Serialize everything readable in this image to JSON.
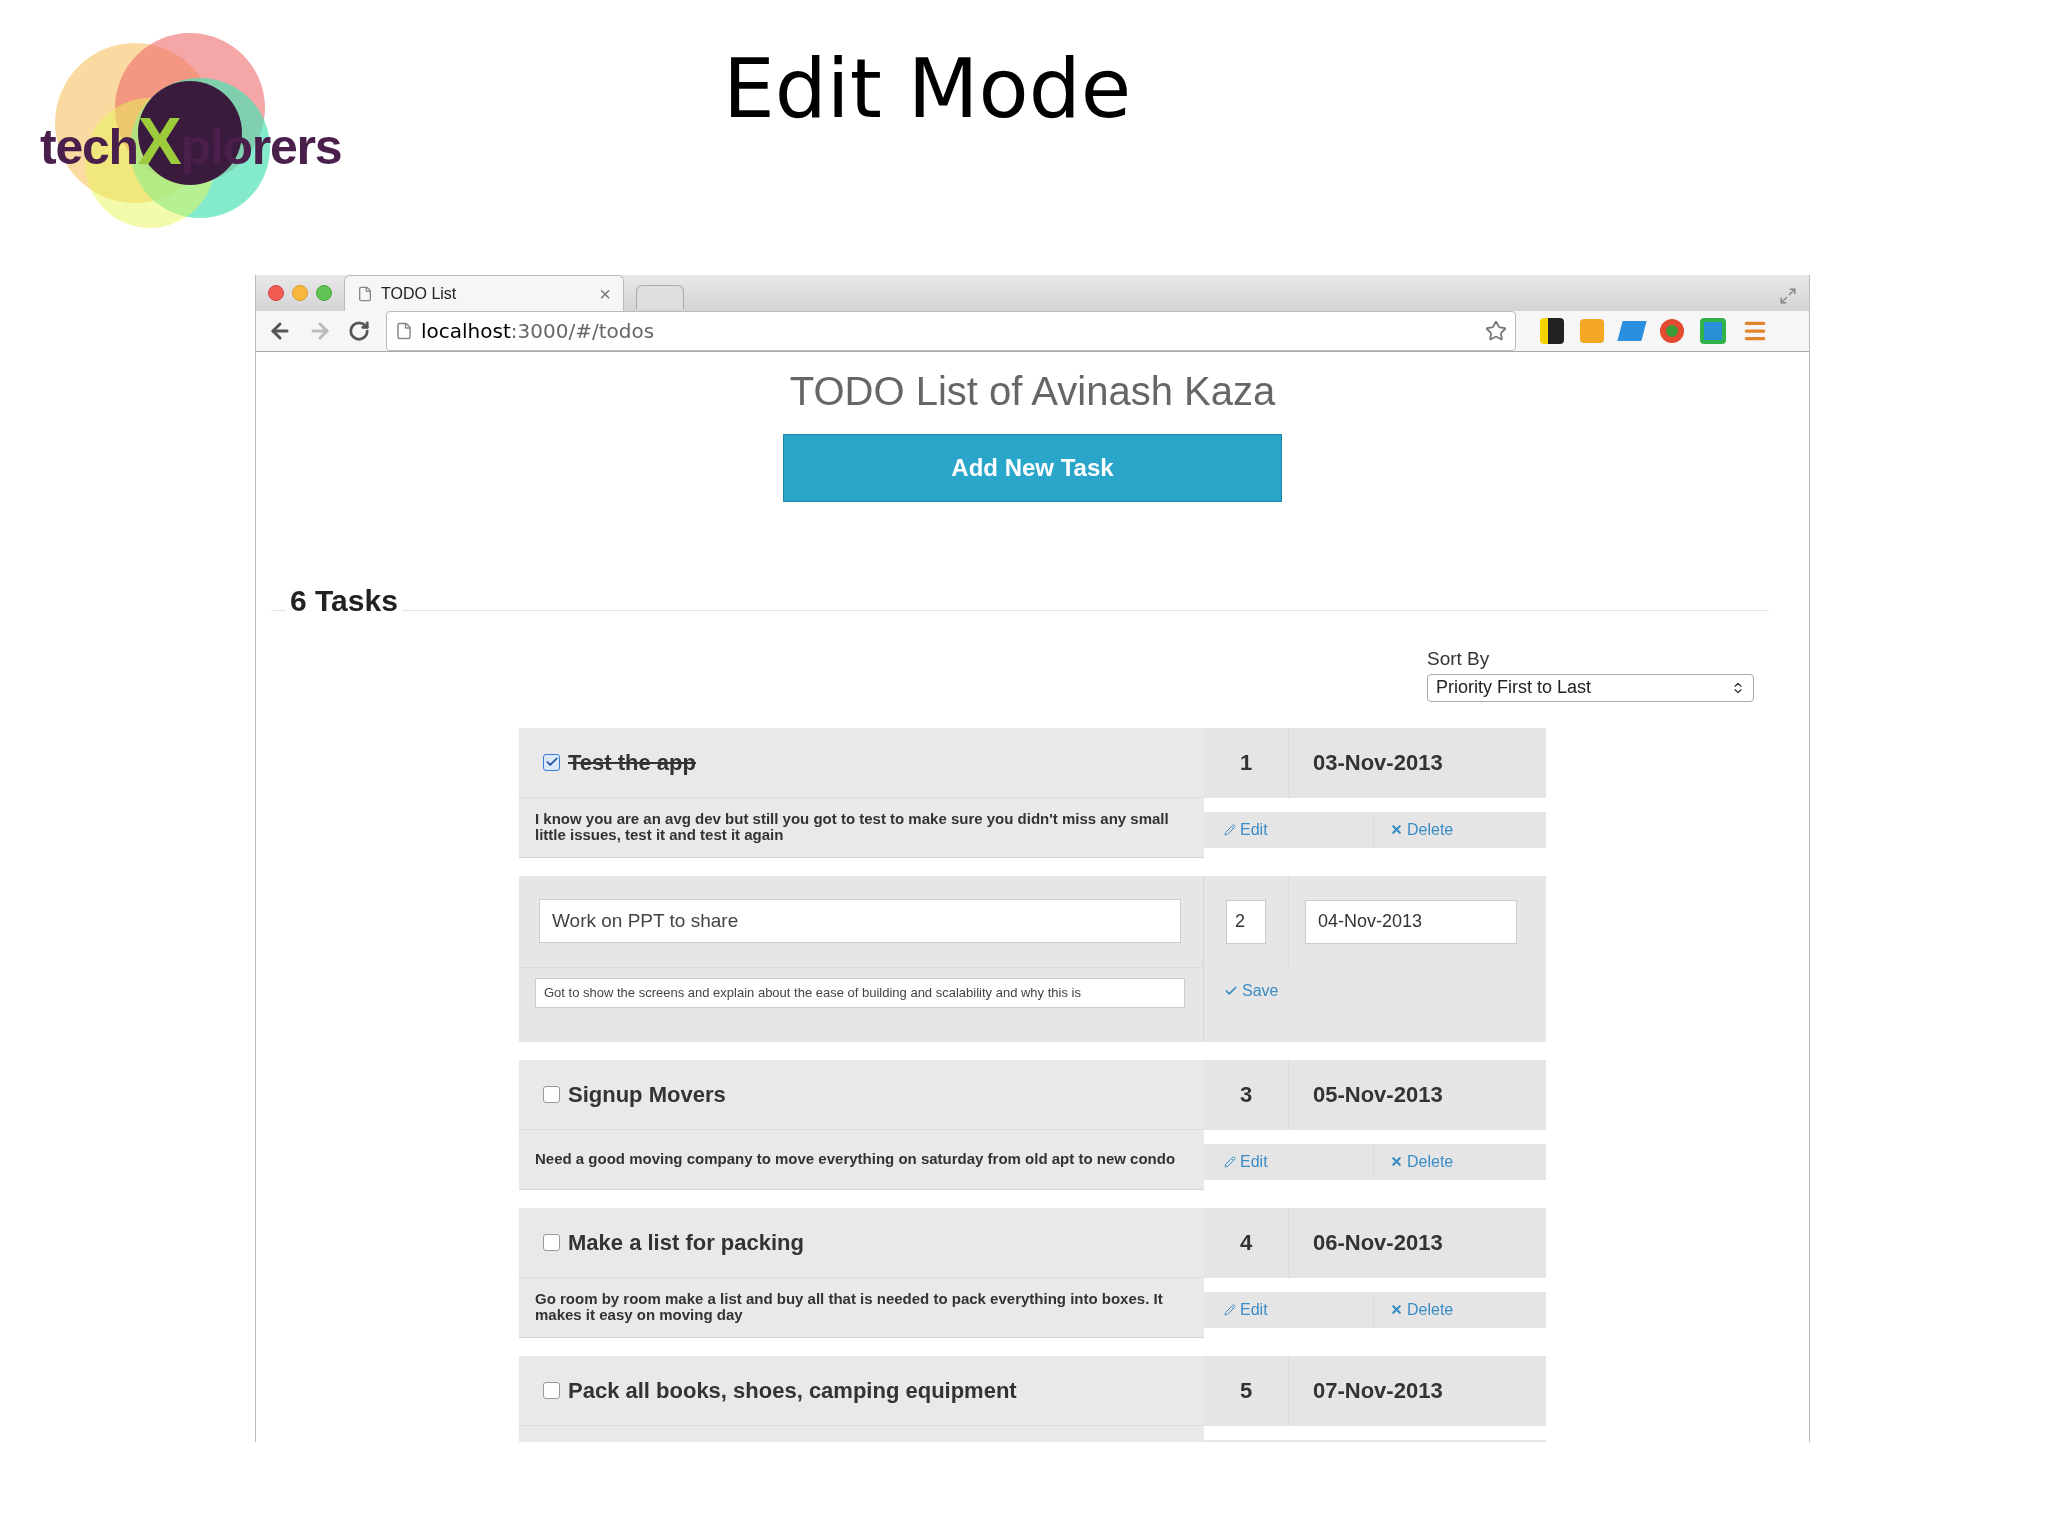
{
  "slide": {
    "title": "Edit Mode",
    "logo": {
      "before": "tech",
      "mark": "X",
      "after": "plorers"
    }
  },
  "browser": {
    "tab": {
      "title": "TODO List",
      "close": "×"
    },
    "address": {
      "host": "localhost",
      "path": ":3000/#/todos"
    }
  },
  "page": {
    "title": "TODO List of Avinash Kaza",
    "add_button": "Add New Task",
    "task_count": "6 Tasks",
    "sort": {
      "label": "Sort By",
      "value": "Priority First to Last"
    },
    "tasks": [
      {
        "kind": "view",
        "checked": true,
        "title": "Test the app",
        "priority": "1",
        "date": "03-Nov-2013",
        "description": "I know you are an avg dev but still you got to test to make sure you didn't miss any small little issues, test it and test it again",
        "edit": "Edit",
        "delete": "Delete"
      },
      {
        "kind": "edit",
        "title": "Work on PPT to share",
        "priority": "2",
        "date": "04-Nov-2013",
        "description": "Got to show the screens and explain about the ease of building and scalability and why this is",
        "save": "Save"
      },
      {
        "kind": "view",
        "checked": false,
        "title": "Signup Movers",
        "priority": "3",
        "date": "05-Nov-2013",
        "description": "Need a good moving company to move everything on saturday from old apt to new condo",
        "edit": "Edit",
        "delete": "Delete"
      },
      {
        "kind": "view",
        "checked": false,
        "title": "Make a list for packing",
        "priority": "4",
        "date": "06-Nov-2013",
        "description": "Go room by room make a list and buy all that is needed to pack everything into boxes. It makes it easy on moving day",
        "edit": "Edit",
        "delete": "Delete"
      },
      {
        "kind": "cut",
        "checked": false,
        "title": "Pack all books, shoes, camping equipment",
        "priority": "5",
        "date": "07-Nov-2013"
      }
    ]
  }
}
